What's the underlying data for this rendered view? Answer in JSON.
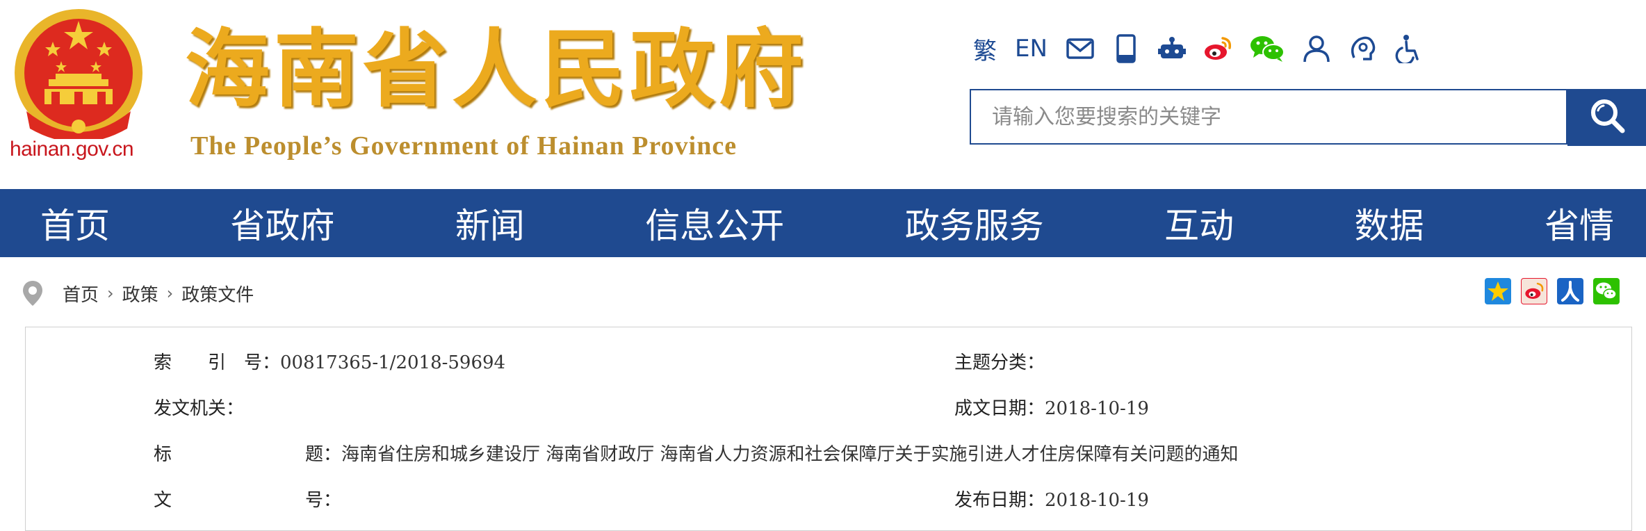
{
  "header": {
    "domain": "hainan.gov.cn",
    "title_cn": "海南省人民政府",
    "title_en": "The People’s Government of Hainan Province",
    "emblem_icon": "national-emblem-icon",
    "tools": {
      "traditional": "繁",
      "english": "EN",
      "icons": [
        "mail-icon",
        "mobile-icon",
        "robot-icon",
        "weibo-icon",
        "wechat-icon",
        "user-icon",
        "elderly-mode-icon",
        "accessibility-icon"
      ]
    },
    "search": {
      "placeholder": "请输入您要搜索的关键字",
      "button_icon": "search-icon"
    },
    "colors": {
      "brand_blue": "#1f4a90",
      "title_gold": "#ecaa1e",
      "domain_red": "#c8161d"
    }
  },
  "nav": [
    "首页",
    "省政府",
    "新闻",
    "信息公开",
    "政务服务",
    "互动",
    "数据",
    "省情"
  ],
  "breadcrumb": [
    "首页",
    "政策",
    "政策文件"
  ],
  "share_icons": [
    "qzone-share-icon",
    "weibo-share-icon",
    "renren-share-icon",
    "wechat-share-icon"
  ],
  "info": {
    "index_label": "索　　引　号：",
    "index_value": "00817365-1/2018-59694",
    "topic_label": "主题分类：",
    "topic_value": "",
    "issuer_label": "发文机关：",
    "issuer_value": "",
    "written_date_label": "成文日期：",
    "written_date_value": "2018-10-19",
    "title_label_a": "标",
    "title_label_b": "题：",
    "title_value": "海南省住房和城乡建设厅 海南省财政厅 海南省人力资源和社会保障厅关于实施引进人才住房保障有关问题的通知",
    "doc_no_label_a": "文",
    "doc_no_label_b": "号：",
    "doc_no_value": "",
    "publish_date_label": "发布日期：",
    "publish_date_value": "2018-10-19"
  }
}
